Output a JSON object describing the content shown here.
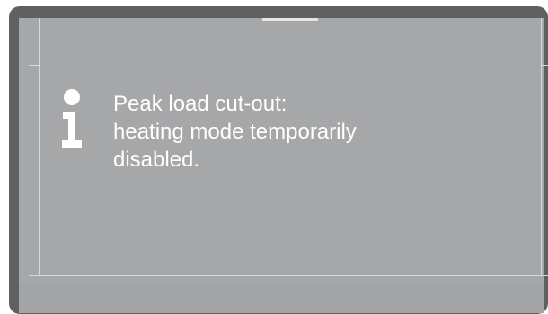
{
  "dialog": {
    "icon": "info-icon",
    "message_lines": [
      "Peak load cut-out:",
      "heating mode temporarily",
      "disabled."
    ]
  },
  "colors": {
    "frame": "#5f6062",
    "screen": "#a6a7a9",
    "text": "#ffffff",
    "lines": "#d8d9da"
  }
}
